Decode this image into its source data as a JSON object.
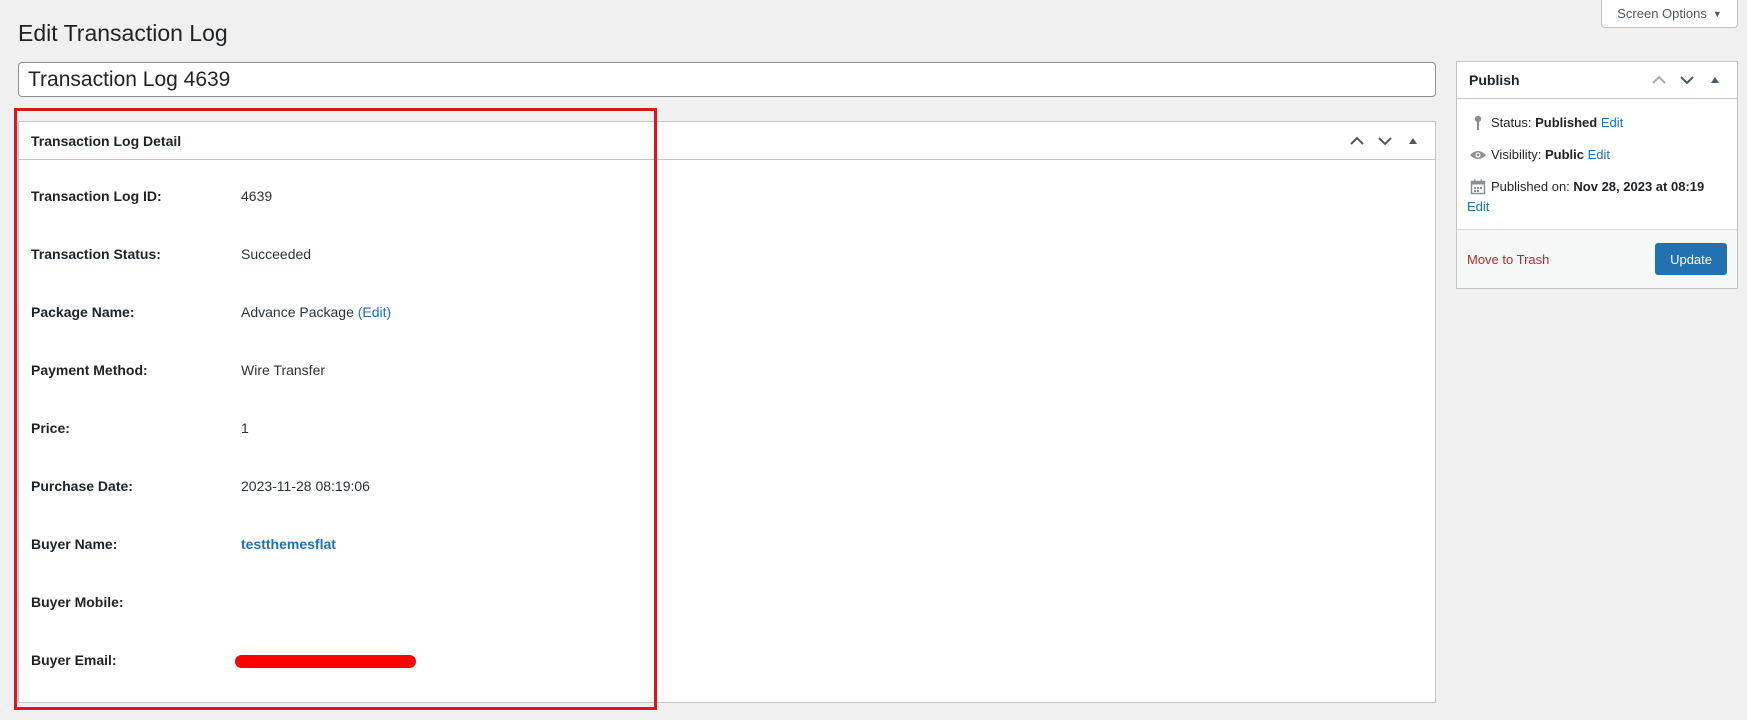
{
  "screen_options": {
    "label": "Screen Options",
    "caret": "▼"
  },
  "page": {
    "title": "Edit Transaction Log"
  },
  "post_title": {
    "value": "Transaction Log 4639"
  },
  "detail_box": {
    "title": "Transaction Log Detail",
    "rows": [
      {
        "label": "Transaction Log ID:",
        "value": "4639"
      },
      {
        "label": "Transaction Status:",
        "value": "Succeeded"
      },
      {
        "label": "Package Name:",
        "value": "Advance Package",
        "link": "(Edit)"
      },
      {
        "label": "Payment Method:",
        "value": "Wire Transfer"
      },
      {
        "label": "Price:",
        "value": "1"
      },
      {
        "label": "Purchase Date:",
        "value": "2023-11-28 08:19:06"
      },
      {
        "label": "Buyer Name:",
        "value": "testthemesflat"
      },
      {
        "label": "Buyer Mobile:",
        "value": ""
      },
      {
        "label": "Buyer Email:",
        "value": ""
      }
    ]
  },
  "publish_box": {
    "title": "Publish",
    "status_label": "Status:",
    "status_value": "Published",
    "visibility_label": "Visibility:",
    "visibility_value": "Public",
    "published_label": "Published on:",
    "published_value": "Nov 28, 2023 at 08:19",
    "edit_label": "Edit",
    "trash_label": "Move to Trash",
    "update_label": "Update"
  },
  "colors": {
    "link": "#2271b1",
    "trash": "#b32d2e",
    "primary_button": "#2271b1",
    "highlight": "#e0141e",
    "redaction": "#ff0000"
  },
  "icons": [
    "chevron-up-icon",
    "chevron-down-icon",
    "triangle-up-icon",
    "pin-icon",
    "eye-icon",
    "calendar-icon"
  ]
}
